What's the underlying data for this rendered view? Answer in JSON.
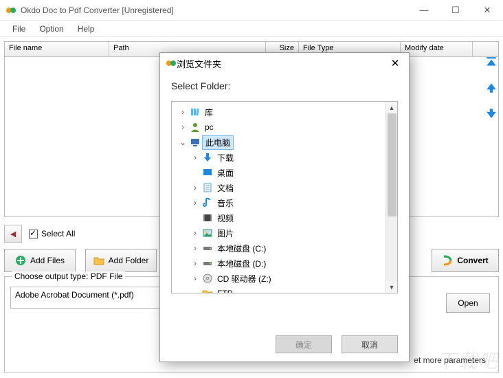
{
  "window": {
    "title": "Okdo Doc to Pdf Converter [Unregistered]"
  },
  "menu": {
    "file": "File",
    "option": "Option",
    "help": "Help"
  },
  "table": {
    "headers": {
      "file": "File name",
      "path": "Path",
      "size": "Size",
      "type": "File Type",
      "date": "Modify date"
    }
  },
  "toolbar": {
    "select_all": "Select All",
    "add_files": "Add Files",
    "add_folder": "Add Folder",
    "convert": "Convert"
  },
  "output": {
    "legend": "Choose output type:  PDF File",
    "select_value": "Adobe Acrobat Document (*.pdf)",
    "open": "Open",
    "more": "et more parameters"
  },
  "dialog": {
    "title": "浏览文件夹",
    "heading": "Select Folder:",
    "btn_ok": "确定",
    "btn_cancel": "取消",
    "tree": [
      {
        "depth": 1,
        "expander": "›",
        "icon": "library",
        "label": "库"
      },
      {
        "depth": 1,
        "expander": "›",
        "icon": "user",
        "label": "pc"
      },
      {
        "depth": 1,
        "expander": "⌄",
        "icon": "computer",
        "label": "此电脑",
        "selected": true
      },
      {
        "depth": 2,
        "expander": "›",
        "icon": "download",
        "label": "下载"
      },
      {
        "depth": 2,
        "expander": "",
        "icon": "desktop",
        "label": "桌面"
      },
      {
        "depth": 2,
        "expander": "›",
        "icon": "document",
        "label": "文档"
      },
      {
        "depth": 2,
        "expander": "›",
        "icon": "music",
        "label": "音乐"
      },
      {
        "depth": 2,
        "expander": "",
        "icon": "video",
        "label": "视频"
      },
      {
        "depth": 2,
        "expander": "›",
        "icon": "picture",
        "label": "图片"
      },
      {
        "depth": 2,
        "expander": "›",
        "icon": "drive",
        "label": "本地磁盘 (C:)"
      },
      {
        "depth": 2,
        "expander": "›",
        "icon": "drive",
        "label": "本地磁盘 (D:)"
      },
      {
        "depth": 2,
        "expander": "›",
        "icon": "cddrive",
        "label": "CD 驱动器 (Z:)"
      },
      {
        "depth": 2,
        "expander": "",
        "icon": "folder",
        "label": "FTP"
      }
    ]
  },
  "colors": {
    "accent_orange": "#f39c12",
    "accent_green": "#27ae60",
    "accent_blue": "#1e88e5"
  }
}
